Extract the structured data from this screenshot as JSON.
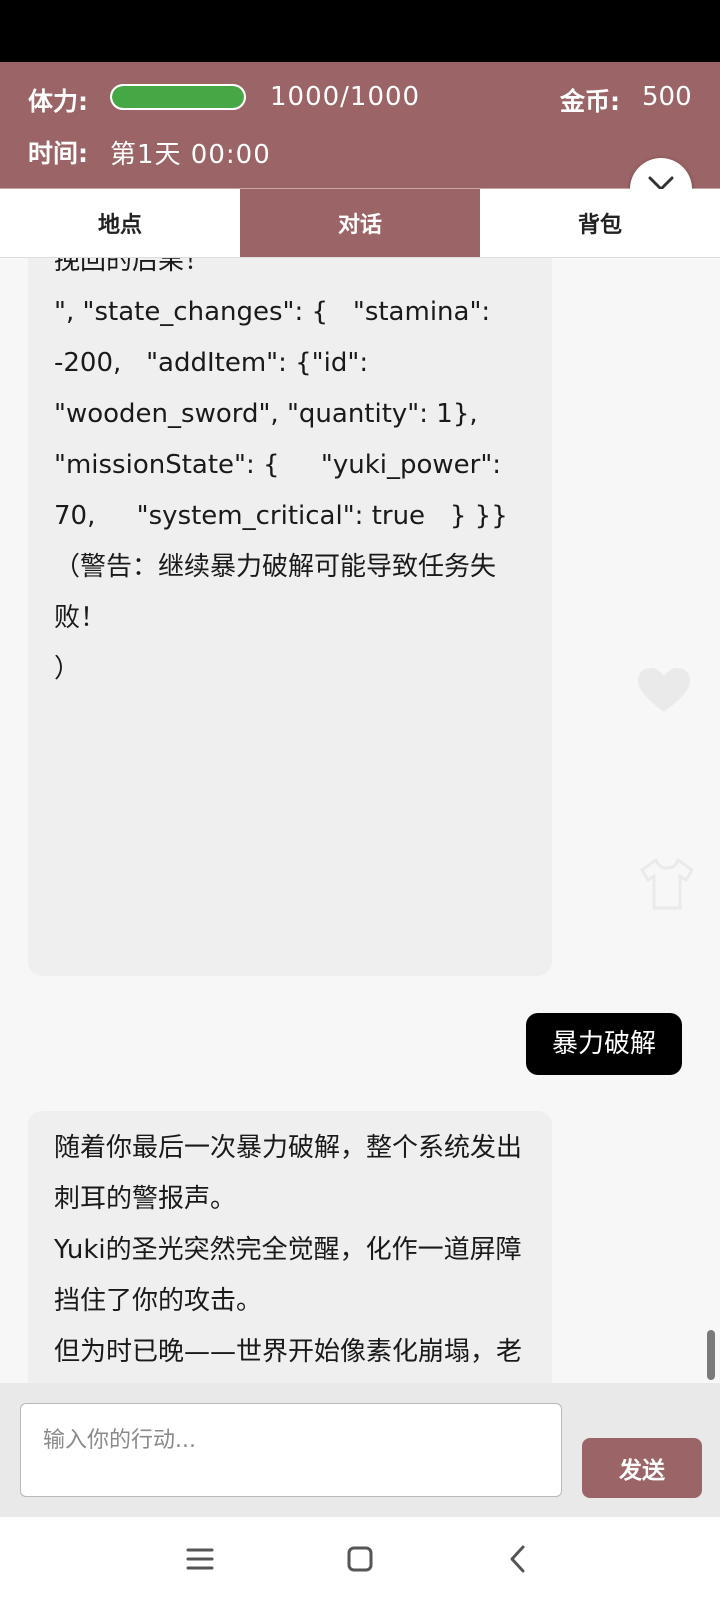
{
  "header": {
    "stamina_label": "体力:",
    "stamina_value": "1000/1000",
    "stamina_fraction": 1.0,
    "gold_label": "金币:",
    "gold_value": "500",
    "time_label": "时间:",
    "time_value": "第1天  00:00",
    "stamina_color": "#45a845",
    "accent_color": "#9b6467"
  },
  "tabs": [
    {
      "label": "地点",
      "active": false
    },
    {
      "label": "对话",
      "active": true
    },
    {
      "label": "背包",
      "active": false
    }
  ],
  "messages": [
    {
      "role": "assistant",
      "text": "挽回的后果！\n\", \"state_changes\": {   \"stamina\": -200,   \"addItem\": {\"id\": \"wooden_sword\", \"quantity\": 1},   \"missionState\": {     \"yuki_power\": 70,     \"system_critical\": true   } }}\n（警告：继续暴力破解可能导致任务失败！\n）"
    },
    {
      "role": "user",
      "text": "暴力破解"
    },
    {
      "role": "assistant",
      "text": "随着你最后一次暴力破解，整个系统发出刺耳的警报声。\nYuki的圣光突然完全觉醒，化作一道屏障挡住了你的攻击。\n但为时已晚——世界开始像素化崩塌，老法师变成了一堆乱码，连魔王都发来了最后一条信息：'早说了直接给你密码...' 在一阵天旋地转中，你和Yuki被强制传送回了原来的世界。"
    }
  ],
  "input": {
    "placeholder": "输入你的行动...",
    "value": ""
  },
  "send_label": "发送",
  "icons": {
    "close": "close-icon",
    "chat_fab": "chat-bubble-icon",
    "nav_menu": "menu-icon",
    "nav_home": "home-icon",
    "nav_back": "back-icon"
  }
}
